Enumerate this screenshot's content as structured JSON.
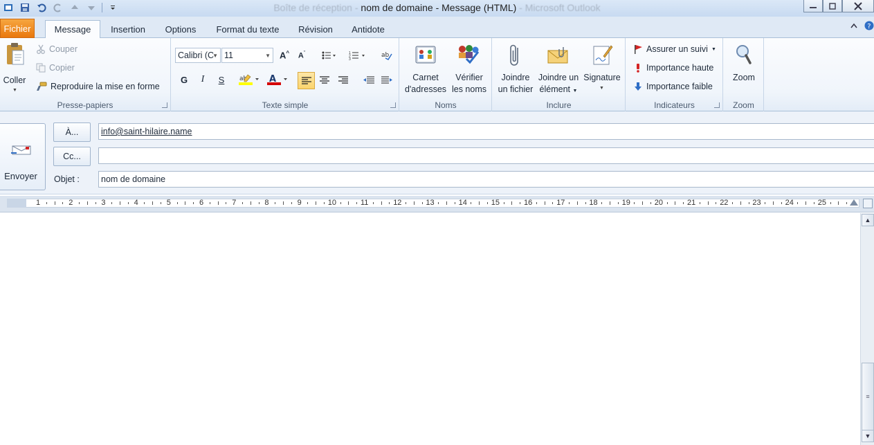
{
  "window": {
    "title_prefix": "Boîte de réception - ",
    "title_main": "nom de domaine - Message (HTML)",
    "title_suffix": " - Microsoft Outlook"
  },
  "tabs": [
    {
      "label": "Fichier"
    },
    {
      "label": "Message"
    },
    {
      "label": "Insertion"
    },
    {
      "label": "Options"
    },
    {
      "label": "Format du texte"
    },
    {
      "label": "Révision"
    },
    {
      "label": "Antidote"
    }
  ],
  "ribbon": {
    "clipboard": {
      "label": "Presse-papiers",
      "paste": "Coller",
      "cut": "Couper",
      "copy": "Copier",
      "format_painter": "Reproduire la mise en forme"
    },
    "basic_text": {
      "label": "Texte simple",
      "font": "Calibri (C",
      "size": "11",
      "bold": "G",
      "italic": "I",
      "underline": "S"
    },
    "names": {
      "label": "Noms",
      "address_book_1": "Carnet",
      "address_book_2": "d'adresses",
      "check_names_1": "Vérifier",
      "check_names_2": "les noms"
    },
    "include": {
      "label": "Inclure",
      "attach_file_1": "Joindre",
      "attach_file_2": "un fichier",
      "attach_item_1": "Joindre un",
      "attach_item_2": "élément",
      "signature": "Signature"
    },
    "tags": {
      "label": "Indicateurs",
      "follow_up": "Assurer un suivi",
      "high_importance": "Importance haute",
      "low_importance": "Importance faible"
    },
    "zoom": {
      "label": "Zoom",
      "button": "Zoom"
    }
  },
  "header": {
    "send": "Envoyer",
    "to_button": "À...",
    "to_value": "info@saint-hilaire.name",
    "cc_button": "Cc...",
    "cc_value": "",
    "subject_label": "Objet :",
    "subject_value": "nom de domaine"
  },
  "ruler": {
    "numbers": [
      "1",
      "2",
      "3",
      "4",
      "5",
      "6",
      "7",
      "8",
      "9",
      "10",
      "11",
      "12",
      "13",
      "14",
      "15",
      "16",
      "17",
      "18",
      "19",
      "20",
      "21",
      "22",
      "23",
      "24",
      "25"
    ]
  },
  "colors": {
    "file_tab": "#e9780d",
    "highlight": "#ffff00",
    "font_color": "#d40000",
    "ribbon_bg": "#f0f5fb"
  }
}
